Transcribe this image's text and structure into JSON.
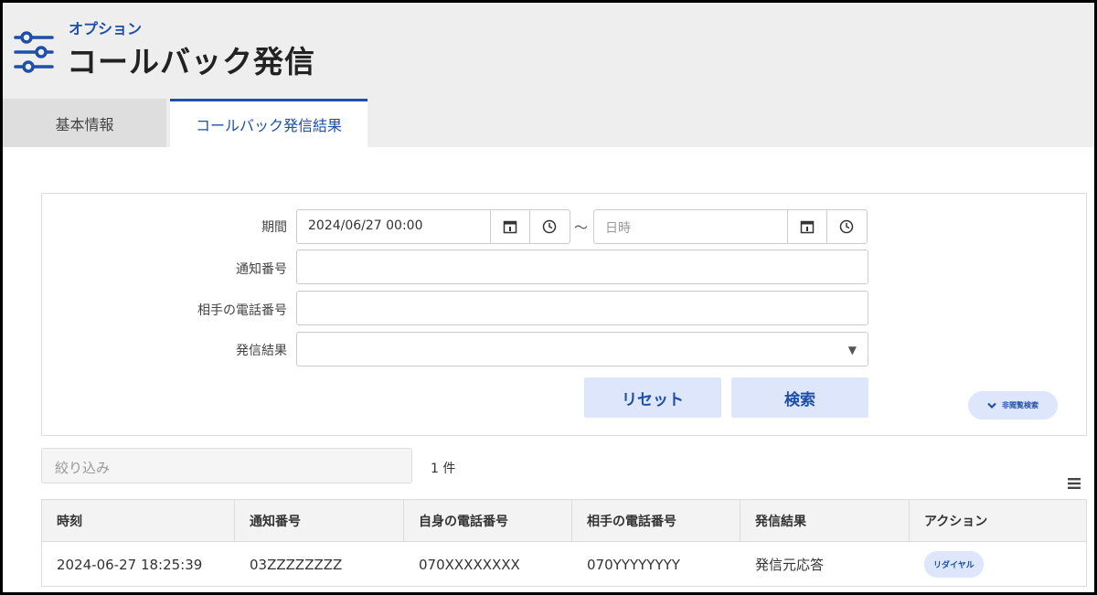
{
  "header": {
    "subtitle": "オプション",
    "title": "コールバック発信"
  },
  "tabs": [
    {
      "label": "基本情報",
      "active": false
    },
    {
      "label": "コールバック発信結果",
      "active": true
    }
  ],
  "search": {
    "period_label": "期間",
    "period_from_value": "2024/06/27 00:00",
    "period_separator": "～",
    "period_to_placeholder": "日時",
    "notification_number_label": "通知番号",
    "notification_number_value": "",
    "partner_phone_label": "相手の電話番号",
    "partner_phone_value": "",
    "result_label": "発信結果",
    "result_value": "",
    "reset_label": "リセット",
    "search_label": "検索",
    "advanced_label": "非閲覧検索"
  },
  "filter": {
    "placeholder": "絞り込み",
    "count": "1 件"
  },
  "table": {
    "columns": [
      "時刻",
      "通知番号",
      "自身の電話番号",
      "相手の電話番号",
      "発信結果",
      "アクション"
    ],
    "rows": [
      {
        "time": "2024-06-27 18:25:39",
        "notification_number": "03ZZZZZZZZ",
        "own_phone": "070XXXXXXXX",
        "partner_phone": "070YYYYYYYY",
        "result": "発信元応答",
        "action": "リダイヤル"
      }
    ]
  },
  "colors": {
    "accent": "#1e4fa8",
    "button_bg": "#dde6fb",
    "header_bg": "#eeeeee"
  },
  "icons": [
    "sliders-icon",
    "calendar-icon",
    "clock-icon",
    "chevron-down-icon",
    "caret-down-icon",
    "menu-icon"
  ]
}
